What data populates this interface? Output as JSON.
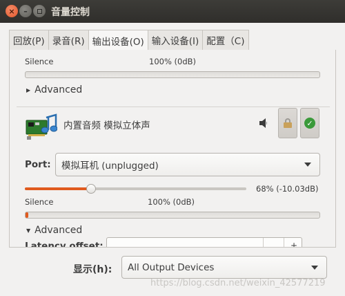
{
  "window": {
    "title": "音量控制"
  },
  "tabs": [
    {
      "label": "回放(P)"
    },
    {
      "label": "录音(R)"
    },
    {
      "label": "输出设备(O)",
      "active": true
    },
    {
      "label": "输入设备(I)"
    },
    {
      "label": "配置（C)"
    }
  ],
  "meter_top": {
    "left_label": "Silence",
    "center_label": "100% (0dB)",
    "level": 0
  },
  "advanced_top": {
    "label": "Advanced",
    "expanded": false
  },
  "device": {
    "icon": "sound-card-icon",
    "name": "内置音频 模拟立体声",
    "speaker_icon": "speaker-icon",
    "lock_icon": "lock-icon",
    "default_icon": "checkmark-icon",
    "port_label": "Port:",
    "port_value": "模拟耳机 (unplugged)",
    "volume_percent": 68,
    "volume_text": "68% (-10.03dB)"
  },
  "meter_bottom": {
    "left_label": "Silence",
    "center_label": "100% (0dB)",
    "level": 0.01
  },
  "advanced_bottom": {
    "label": "Advanced",
    "expanded": true
  },
  "latency": {
    "label": "Latency offset:",
    "plus": "+"
  },
  "footer": {
    "show_label": "显示(h):",
    "show_value": "All Output Devices"
  },
  "watermark": "https://blog.csdn.net/weixin_42577219",
  "colors": {
    "accent": "#e05a1e",
    "titlebar": "#3d3c38",
    "background": "#f2f1f0"
  }
}
